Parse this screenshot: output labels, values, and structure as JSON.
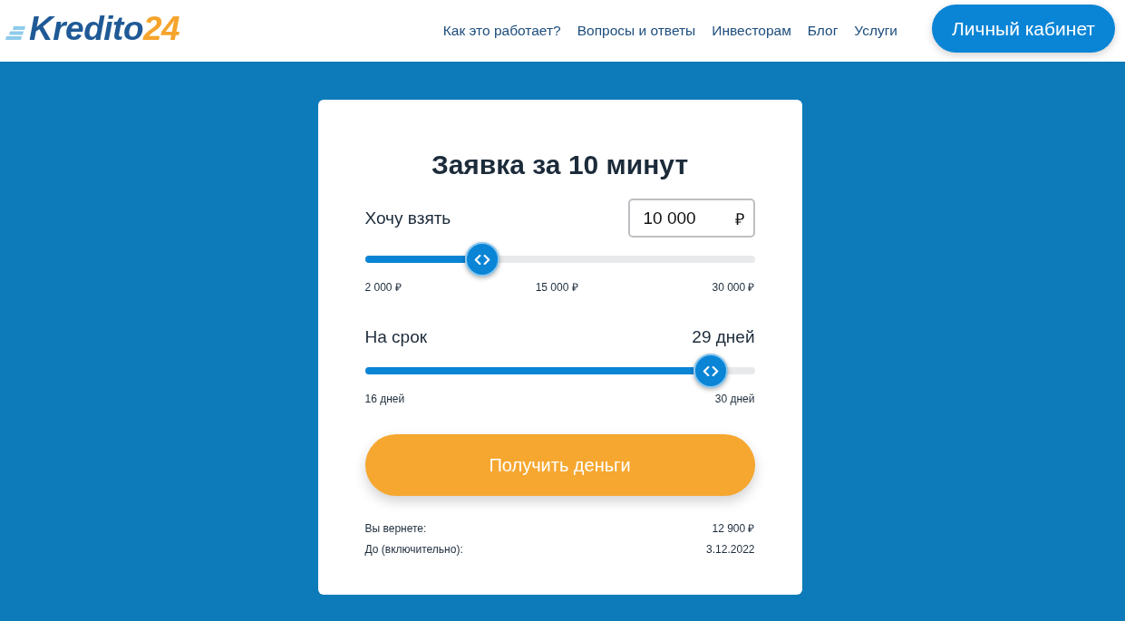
{
  "header": {
    "logo": {
      "text": "Kredito",
      "accent": "24"
    },
    "nav": [
      "Как это работает?",
      "Вопросы и ответы",
      "Инвесторам",
      "Блог",
      "Услуги"
    ],
    "account_button": "Личный кабинет"
  },
  "form": {
    "title": "Заявка за 10 минут",
    "sliders": [
      {
        "kind": "input",
        "label": "Хочу взять",
        "value": "10 000",
        "currency": "₽",
        "level": 0.3,
        "ticks": [
          "2 000 ₽",
          "15 000 ₽",
          "30 000 ₽"
        ]
      },
      {
        "kind": "reading",
        "label": "На срок",
        "value": "29 дней",
        "level": 0.888,
        "ticks": [
          "16 дней",
          "30 дней"
        ]
      }
    ],
    "submit_button": "Получить деньги",
    "summary": [
      {
        "label": "Вы вернете:",
        "value": "12 900 ₽"
      },
      {
        "label": "До (включительно):",
        "value": "3.12.2022"
      }
    ]
  }
}
